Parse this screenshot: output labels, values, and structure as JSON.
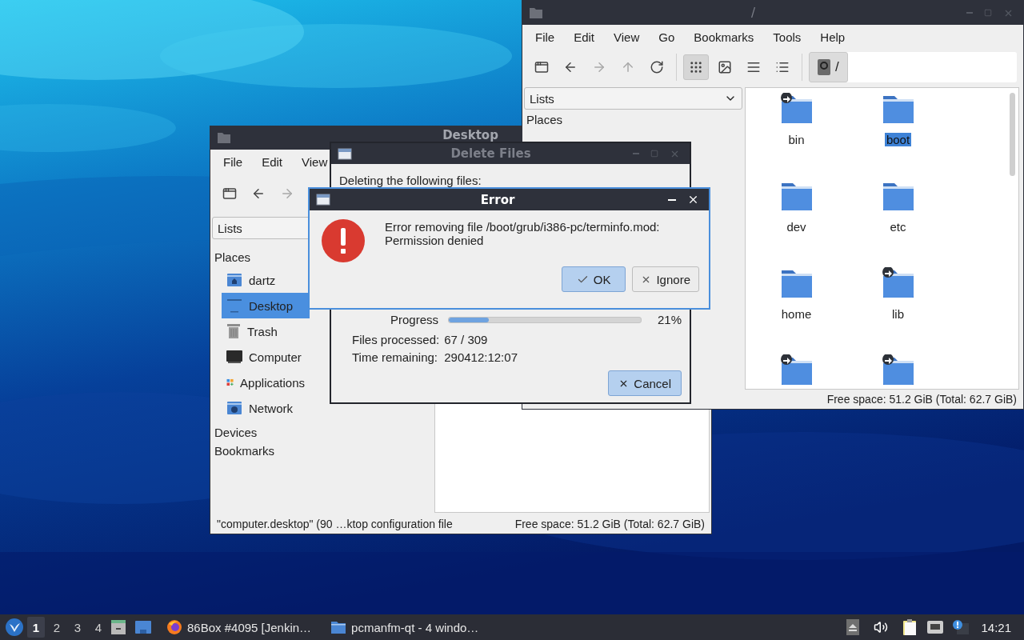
{
  "root_window": {
    "title": "/",
    "menu": [
      "File",
      "Edit",
      "View",
      "Go",
      "Bookmarks",
      "Tools",
      "Help"
    ],
    "nav": [
      {
        "kind": "new-tab",
        "disabled": false
      },
      {
        "kind": "back",
        "disabled": false
      },
      {
        "kind": "forward",
        "disabled": true
      },
      {
        "kind": "up",
        "disabled": true
      },
      {
        "kind": "reload",
        "disabled": false
      }
    ],
    "views": [
      {
        "kind": "icons",
        "selected": true
      },
      {
        "kind": "thumbnails",
        "selected": false
      },
      {
        "kind": "compact",
        "selected": false
      },
      {
        "kind": "details",
        "selected": false
      }
    ],
    "path": "/",
    "selector": "Lists",
    "sections": [
      "Places"
    ],
    "files": [
      {
        "name": "bin",
        "link": true,
        "selected": false
      },
      {
        "name": "boot",
        "link": false,
        "selected": true
      },
      {
        "name": "dev",
        "link": false,
        "selected": false
      },
      {
        "name": "etc",
        "link": false,
        "selected": false
      },
      {
        "name": "home",
        "link": false,
        "selected": false
      },
      {
        "name": "lib",
        "link": true,
        "selected": false
      },
      {
        "link": true
      },
      {
        "link": true
      }
    ],
    "status": "Free space: 51.2 GiB (Total: 62.7 GiB)"
  },
  "desktop_window": {
    "title": "Desktop",
    "menu": [
      "File",
      "Edit",
      "View"
    ],
    "nav": [
      {
        "kind": "new-tab",
        "disabled": false
      },
      {
        "kind": "back",
        "disabled": false
      },
      {
        "kind": "forward",
        "disabled": true
      }
    ],
    "selector": "Lists",
    "places_label": "Places",
    "places": [
      {
        "label": "dartz",
        "kind": "home",
        "selected": false
      },
      {
        "label": "Desktop",
        "kind": "desktop",
        "selected": true
      },
      {
        "label": "Trash",
        "kind": "trash",
        "selected": false
      },
      {
        "label": "Computer",
        "kind": "computer",
        "selected": false
      },
      {
        "label": "Applications",
        "kind": "apps",
        "selected": false
      },
      {
        "label": "Network",
        "kind": "network",
        "selected": false
      }
    ],
    "sections": [
      "Devices",
      "Bookmarks"
    ],
    "status_left": "\"computer.desktop\" (90 …ktop configuration file",
    "status_right": "Free space: 51.2 GiB (Total: 62.7 GiB)"
  },
  "delete_dialog": {
    "title": "Delete Files",
    "heading": "Deleting the following files:",
    "progress_label": "Progress",
    "level": 0.21,
    "percent": "21%",
    "stats": [
      {
        "label": "Files processed:",
        "value": "67 / 309"
      },
      {
        "label": "Time remaining:",
        "value": "290412:12:07"
      }
    ],
    "cancel": "Cancel"
  },
  "error_dialog": {
    "title": "Error",
    "message": "Error removing file /boot/grub/i386-pc/terminfo.mod: Permission denied",
    "buttons": [
      {
        "label": "OK",
        "kind": "ok",
        "default": true
      },
      {
        "label": "Ignore",
        "kind": "ignore",
        "default": false
      }
    ]
  },
  "taskbar": {
    "workspaces": [
      {
        "label": "1",
        "selected": true
      },
      {
        "label": "2",
        "selected": false
      },
      {
        "label": "3",
        "selected": false
      },
      {
        "label": "4",
        "selected": false
      }
    ],
    "tasks": [
      {
        "label": "86Box #4095 [Jenkin…",
        "kind": "browser"
      },
      {
        "label": "pcmanfm-qt - 4 windo…",
        "kind": "folder"
      }
    ],
    "clock": "14:21"
  }
}
